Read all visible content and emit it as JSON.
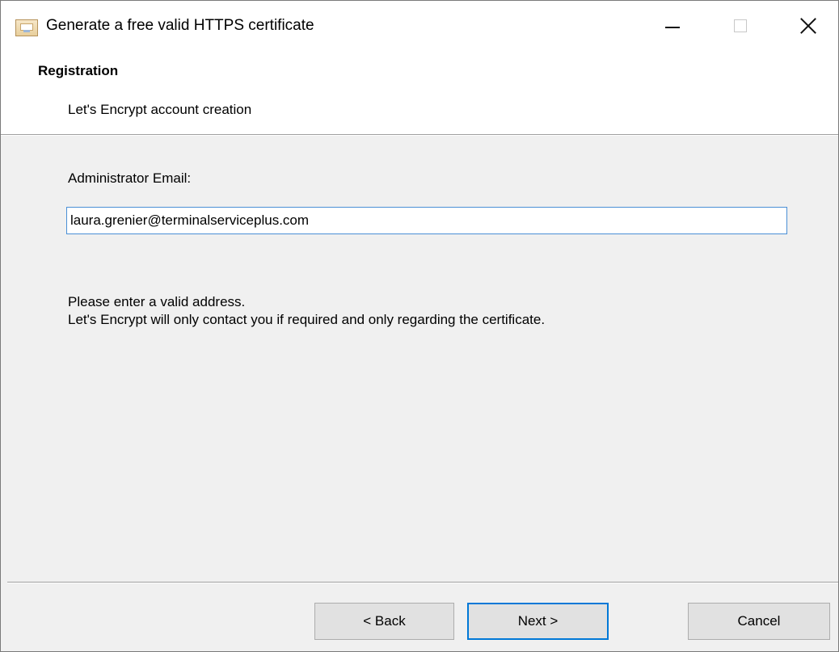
{
  "window": {
    "title": "Generate a free valid HTTPS certificate",
    "app_icon": "certificate-icon",
    "controls": {
      "minimize": "minimize-icon",
      "maximize": "maximize-icon",
      "close": "close-icon"
    }
  },
  "header": {
    "title": "Registration",
    "subtitle": "Let's Encrypt account creation"
  },
  "form": {
    "email_label": "Administrator Email:",
    "email_value": "laura.grenier@terminalserviceplus.com",
    "help_line1": "Please enter a valid address.",
    "help_line2": "Let's Encrypt will only contact you if required and only regarding the certificate."
  },
  "buttons": {
    "back": "< Back",
    "next": "Next >",
    "cancel": "Cancel"
  },
  "colors": {
    "focus_accent": "#0078d7",
    "input_border": "#4a8fd6",
    "background": "#f0f0f0"
  }
}
